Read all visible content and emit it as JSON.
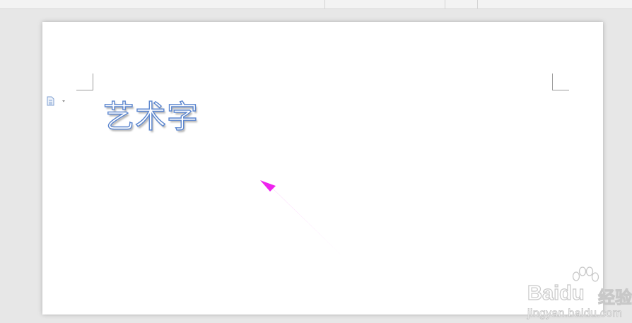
{
  "document": {
    "wordart_text": "艺术字"
  },
  "watermark": {
    "brand": "Baidu",
    "product": "经验",
    "url": "jingyan.baidu.com"
  },
  "colors": {
    "wordart_outline": "#5b86cf",
    "arrow": "#ee22ee",
    "page": "#ffffff",
    "workspace": "#e7e7e7"
  },
  "icons": {
    "paragraph_layout": "document-icon",
    "dropdown": "chevron-down-icon"
  }
}
